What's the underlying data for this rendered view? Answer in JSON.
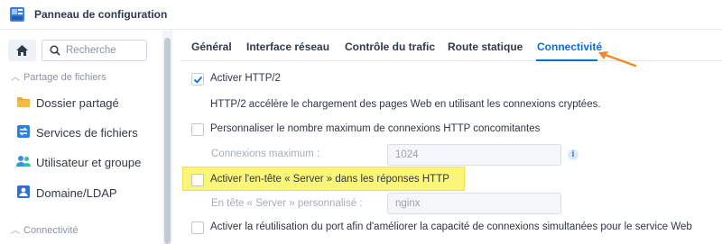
{
  "window": {
    "title": "Panneau de configuration",
    "icon": "control-panel-icon"
  },
  "sidebar": {
    "search": {
      "placeholder": "Recherche",
      "value": ""
    },
    "sections": [
      {
        "label": "Partage de fichiers",
        "items": [
          {
            "label": "Dossier partagé",
            "icon": "shared-folder-icon"
          },
          {
            "label": "Services de fichiers",
            "icon": "file-services-icon"
          },
          {
            "label": "Utilisateur et groupe",
            "icon": "user-group-icon"
          },
          {
            "label": "Domaine/LDAP",
            "icon": "domain-ldap-icon"
          }
        ]
      },
      {
        "label": "Connectivité",
        "items": []
      }
    ]
  },
  "tabs": [
    {
      "label": "Général",
      "active": false
    },
    {
      "label": "Interface réseau",
      "active": false
    },
    {
      "label": "Contrôle du trafic",
      "active": false
    },
    {
      "label": "Route statique",
      "active": false
    },
    {
      "label": "Connectivité",
      "active": true
    }
  ],
  "settings": {
    "http2": {
      "label": "Activer HTTP/2",
      "checked": true,
      "description": "HTTP/2 accélère le chargement des pages Web en utilisant les connexions cryptées."
    },
    "max_connections": {
      "label": "Personnaliser le nombre maximum de connexions HTTP concomitantes",
      "checked": false,
      "field_label": "Connexions maximum :",
      "field_value": "1024"
    },
    "server_header": {
      "label": "Activer l'en-tête « Server » dans les réponses HTTP",
      "checked": false,
      "field_label": "En tête « Server » personnalisé :",
      "field_value": "nginx"
    },
    "port_reuse": {
      "label": "Activer la réutilisation du port afin d'améliorer la capacité de connexions simultanées pour le service Web",
      "checked": false
    }
  },
  "colors": {
    "accent": "#0a6fd1",
    "highlight": "#fbf57a",
    "arrow": "#f08a24"
  }
}
